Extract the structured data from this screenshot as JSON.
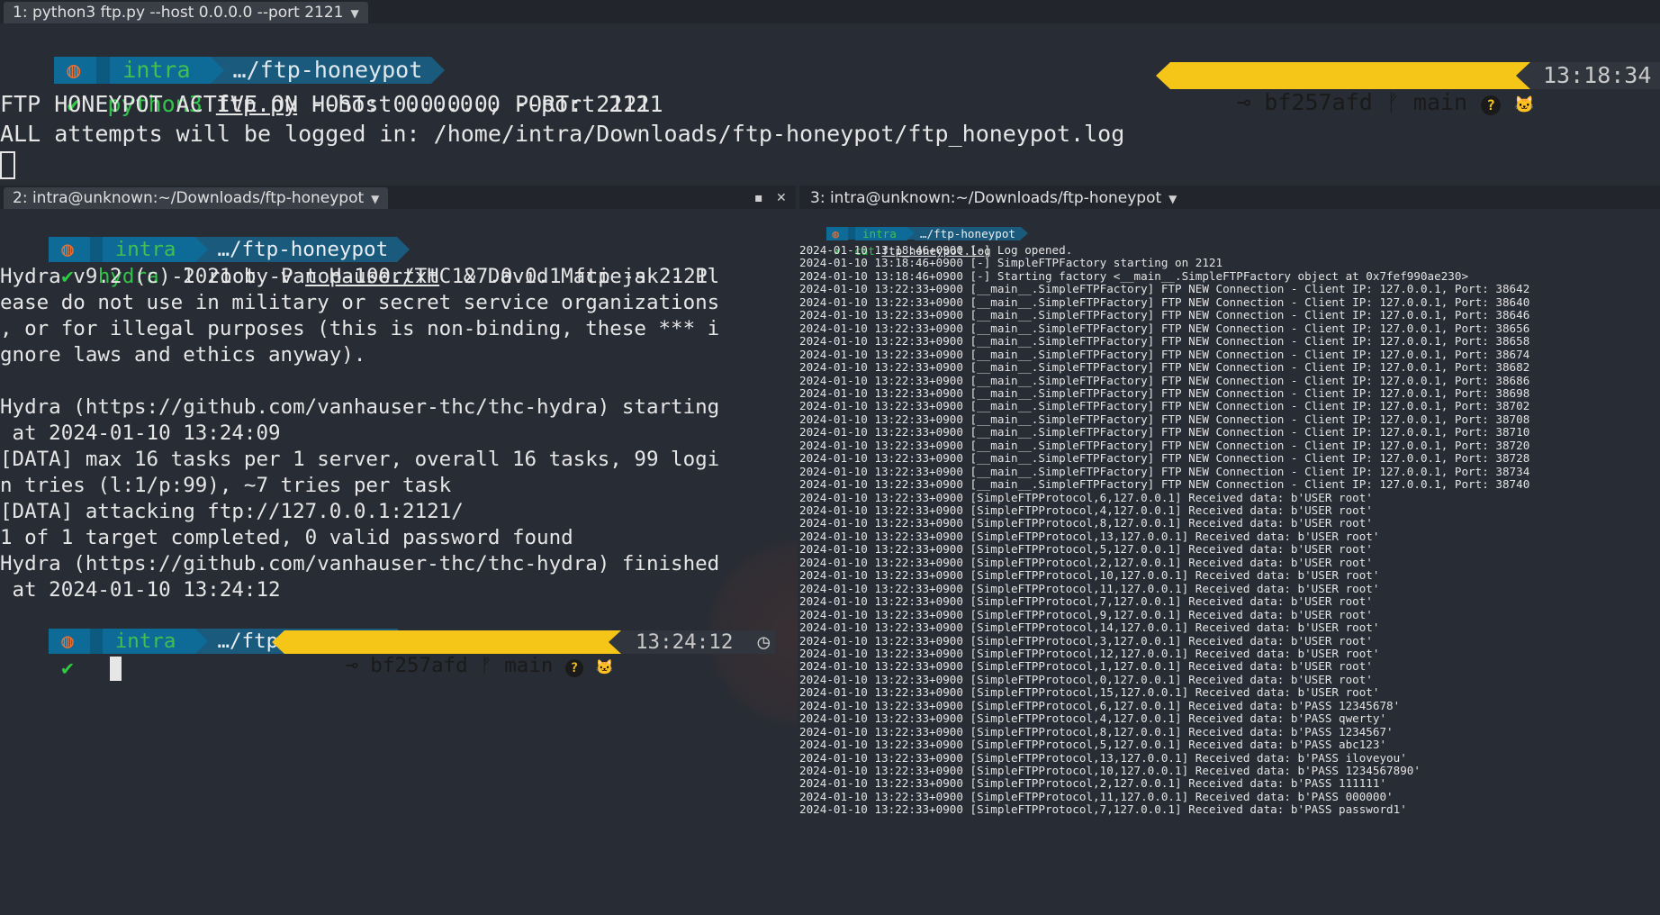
{
  "colors": {
    "background": "#282c34",
    "prompt_segment": "#0e6a96",
    "os_icon": "#f07030",
    "check": "#2ecc40",
    "command": "#33c24a",
    "git_segment": "#f5c518",
    "time_segment": "#31353d"
  },
  "icons": {
    "os": "ubuntu-icon",
    "check": "check-icon",
    "commit": "git-commit-icon",
    "branch": "git-branch-icon",
    "clock": "clock-icon"
  },
  "glyphs": {
    "ubuntu": "◍",
    "check": "✔",
    "commit": "⊸",
    "branch": "ᚠ",
    "question": "?",
    "cat": "🐱",
    "clock": "◷",
    "caret": "▼",
    "maximize": "▪",
    "close": "✕"
  },
  "tabs": {
    "pane1_title": "1: python3 ftp.py --host 0.0.0.0 --port 2121",
    "pane2_title": "2: intra@unknown:~/Downloads/ftp-honeypot",
    "pane3_title": "3: intra@unknown:~/Downloads/ftp-honeypot"
  },
  "prompt": {
    "user": "intra",
    "dir": "…/ftp-honeypot",
    "hash": "bf257afd",
    "branch": "main"
  },
  "pane1": {
    "cmd_name": "python3",
    "cmd_file": "ftp.py",
    "cmd_args": " --host 0.0.0.0 --port 2121",
    "time": "13:18:34",
    "output": [
      "FTP HONEYPOT ACTIVE ON HOST: 0.0.0.0, PORT: 2121",
      "ALL attempts will be logged in: /home/intra/Downloads/ftp-honeypot/ftp_honeypot.log"
    ]
  },
  "pane2": {
    "cmd_name": "hydra",
    "cmd_args1": " -l root -P ",
    "cmd_file": "top-100.txt",
    "cmd_args2": " 127.0.0.1 ftp -s 2121",
    "output": [
      "Hydra v9.2 (c) 2021 by van Hauser/THC & David Maciejak - Pl",
      "ease do not use in military or secret service organizations",
      ", or for illegal purposes (this is non-binding, these *** i",
      "gnore laws and ethics anyway).",
      "",
      "Hydra (https://github.com/vanhauser-thc/thc-hydra) starting",
      " at 2024-01-10 13:24:09",
      "[DATA] max 16 tasks per 1 server, overall 16 tasks, 99 logi",
      "n tries (l:1/p:99), ~7 tries per task",
      "[DATA] attacking ftp://127.0.0.1:2121/",
      "1 of 1 target completed, 0 valid password found",
      "Hydra (https://github.com/vanhauser-thc/thc-hydra) finished",
      " at 2024-01-10 13:24:12"
    ],
    "time": "13:24:12"
  },
  "pane3": {
    "cmd_name": "cat",
    "cmd_file": "ftp_honeypot.log",
    "log": [
      "2024-01-10 13:18:46+0900 [-] Log opened.",
      "2024-01-10 13:18:46+0900 [-] SimpleFTPFactory starting on 2121",
      "2024-01-10 13:18:46+0900 [-] Starting factory <__main__.SimpleFTPFactory object at 0x7fef990ae230>",
      "2024-01-10 13:22:33+0900 [__main__.SimpleFTPFactory] FTP NEW Connection - Client IP: 127.0.0.1, Port: 38642",
      "2024-01-10 13:22:33+0900 [__main__.SimpleFTPFactory] FTP NEW Connection - Client IP: 127.0.0.1, Port: 38640",
      "2024-01-10 13:22:33+0900 [__main__.SimpleFTPFactory] FTP NEW Connection - Client IP: 127.0.0.1, Port: 38646",
      "2024-01-10 13:22:33+0900 [__main__.SimpleFTPFactory] FTP NEW Connection - Client IP: 127.0.0.1, Port: 38656",
      "2024-01-10 13:22:33+0900 [__main__.SimpleFTPFactory] FTP NEW Connection - Client IP: 127.0.0.1, Port: 38658",
      "2024-01-10 13:22:33+0900 [__main__.SimpleFTPFactory] FTP NEW Connection - Client IP: 127.0.0.1, Port: 38674",
      "2024-01-10 13:22:33+0900 [__main__.SimpleFTPFactory] FTP NEW Connection - Client IP: 127.0.0.1, Port: 38682",
      "2024-01-10 13:22:33+0900 [__main__.SimpleFTPFactory] FTP NEW Connection - Client IP: 127.0.0.1, Port: 38686",
      "2024-01-10 13:22:33+0900 [__main__.SimpleFTPFactory] FTP NEW Connection - Client IP: 127.0.0.1, Port: 38698",
      "2024-01-10 13:22:33+0900 [__main__.SimpleFTPFactory] FTP NEW Connection - Client IP: 127.0.0.1, Port: 38702",
      "2024-01-10 13:22:33+0900 [__main__.SimpleFTPFactory] FTP NEW Connection - Client IP: 127.0.0.1, Port: 38708",
      "2024-01-10 13:22:33+0900 [__main__.SimpleFTPFactory] FTP NEW Connection - Client IP: 127.0.0.1, Port: 38710",
      "2024-01-10 13:22:33+0900 [__main__.SimpleFTPFactory] FTP NEW Connection - Client IP: 127.0.0.1, Port: 38720",
      "2024-01-10 13:22:33+0900 [__main__.SimpleFTPFactory] FTP NEW Connection - Client IP: 127.0.0.1, Port: 38728",
      "2024-01-10 13:22:33+0900 [__main__.SimpleFTPFactory] FTP NEW Connection - Client IP: 127.0.0.1, Port: 38734",
      "2024-01-10 13:22:33+0900 [__main__.SimpleFTPFactory] FTP NEW Connection - Client IP: 127.0.0.1, Port: 38740",
      "2024-01-10 13:22:33+0900 [SimpleFTPProtocol,6,127.0.0.1] Received data: b'USER root'",
      "2024-01-10 13:22:33+0900 [SimpleFTPProtocol,4,127.0.0.1] Received data: b'USER root'",
      "2024-01-10 13:22:33+0900 [SimpleFTPProtocol,8,127.0.0.1] Received data: b'USER root'",
      "2024-01-10 13:22:33+0900 [SimpleFTPProtocol,13,127.0.0.1] Received data: b'USER root'",
      "2024-01-10 13:22:33+0900 [SimpleFTPProtocol,5,127.0.0.1] Received data: b'USER root'",
      "2024-01-10 13:22:33+0900 [SimpleFTPProtocol,2,127.0.0.1] Received data: b'USER root'",
      "2024-01-10 13:22:33+0900 [SimpleFTPProtocol,10,127.0.0.1] Received data: b'USER root'",
      "2024-01-10 13:22:33+0900 [SimpleFTPProtocol,11,127.0.0.1] Received data: b'USER root'",
      "2024-01-10 13:22:33+0900 [SimpleFTPProtocol,7,127.0.0.1] Received data: b'USER root'",
      "2024-01-10 13:22:33+0900 [SimpleFTPProtocol,9,127.0.0.1] Received data: b'USER root'",
      "2024-01-10 13:22:33+0900 [SimpleFTPProtocol,14,127.0.0.1] Received data: b'USER root'",
      "2024-01-10 13:22:33+0900 [SimpleFTPProtocol,3,127.0.0.1] Received data: b'USER root'",
      "2024-01-10 13:22:33+0900 [SimpleFTPProtocol,12,127.0.0.1] Received data: b'USER root'",
      "2024-01-10 13:22:33+0900 [SimpleFTPProtocol,1,127.0.0.1] Received data: b'USER root'",
      "2024-01-10 13:22:33+0900 [SimpleFTPProtocol,0,127.0.0.1] Received data: b'USER root'",
      "2024-01-10 13:22:33+0900 [SimpleFTPProtocol,15,127.0.0.1] Received data: b'USER root'",
      "2024-01-10 13:22:33+0900 [SimpleFTPProtocol,6,127.0.0.1] Received data: b'PASS 12345678'",
      "2024-01-10 13:22:33+0900 [SimpleFTPProtocol,4,127.0.0.1] Received data: b'PASS qwerty'",
      "2024-01-10 13:22:33+0900 [SimpleFTPProtocol,8,127.0.0.1] Received data: b'PASS 1234567'",
      "2024-01-10 13:22:33+0900 [SimpleFTPProtocol,5,127.0.0.1] Received data: b'PASS abc123'",
      "2024-01-10 13:22:33+0900 [SimpleFTPProtocol,13,127.0.0.1] Received data: b'PASS iloveyou'",
      "2024-01-10 13:22:33+0900 [SimpleFTPProtocol,10,127.0.0.1] Received data: b'PASS 1234567890'",
      "2024-01-10 13:22:33+0900 [SimpleFTPProtocol,2,127.0.0.1] Received data: b'PASS 111111'",
      "2024-01-10 13:22:33+0900 [SimpleFTPProtocol,11,127.0.0.1] Received data: b'PASS 000000'",
      "2024-01-10 13:22:33+0900 [SimpleFTPProtocol,7,127.0.0.1] Received data: b'PASS password1'"
    ]
  }
}
